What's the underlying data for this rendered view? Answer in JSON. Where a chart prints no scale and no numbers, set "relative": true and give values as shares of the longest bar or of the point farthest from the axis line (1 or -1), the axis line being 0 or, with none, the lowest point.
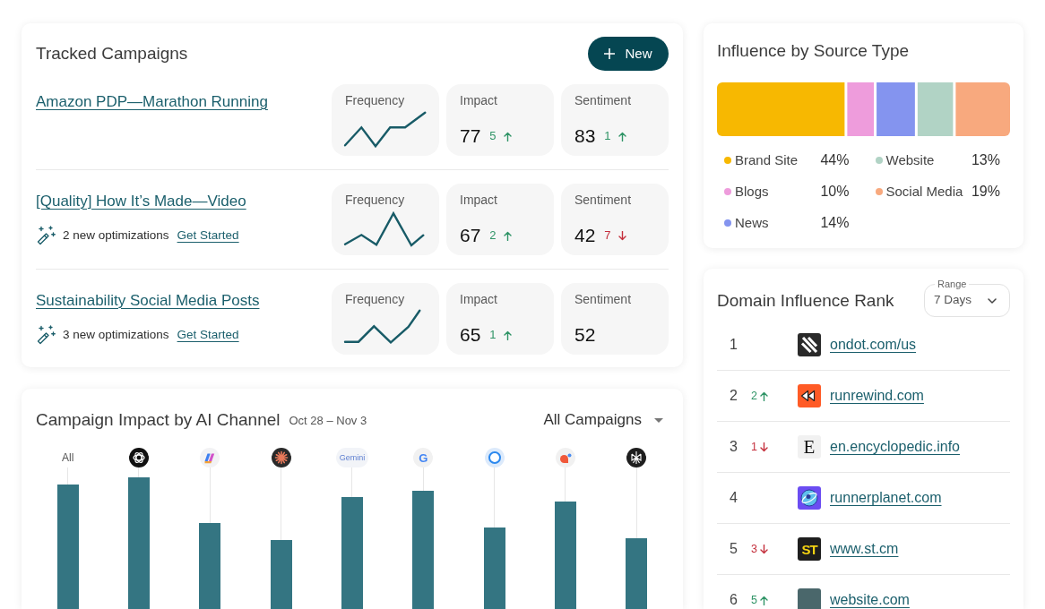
{
  "tracked_campaigns": {
    "title": "Tracked Campaigns",
    "new_button": "New",
    "campaigns": [
      {
        "title": "Amazon PDP—Marathon Running",
        "metrics": [
          {
            "kind": "sparkline",
            "label": "Frequency"
          },
          {
            "kind": "score",
            "label": "Impact",
            "value": "77",
            "change": "5",
            "rising": true
          },
          {
            "kind": "score",
            "label": "Sentiment",
            "value": "83",
            "change": "1",
            "rising": true
          }
        ]
      },
      {
        "title": "[Quality] How It’s Made—Video",
        "optimizations": {
          "text": "2 new optimizations",
          "link": "Get Started"
        },
        "metrics": [
          {
            "kind": "sparkline",
            "label": "Frequency"
          },
          {
            "kind": "score",
            "label": "Impact",
            "value": "67",
            "change": "2",
            "rising": true
          },
          {
            "kind": "score",
            "label": "Sentiment",
            "value": "42",
            "change": "7",
            "rising": false
          }
        ]
      },
      {
        "title": "Sustainability Social Media Posts",
        "optimizations": {
          "text": "3 new optimizations",
          "link": "Get Started"
        },
        "metrics": [
          {
            "kind": "sparkline",
            "label": "Frequency"
          },
          {
            "kind": "score",
            "label": "Impact",
            "value": "65",
            "change": "1",
            "rising": true
          },
          {
            "kind": "score",
            "label": "Sentiment",
            "value": "52"
          }
        ]
      }
    ]
  },
  "impact_chart": {
    "title": "Campaign Impact by AI Channel",
    "date_range": "Oct 28 – Nov 3",
    "filter": "All Campaigns",
    "channels": [
      {
        "kind": "text",
        "label": "All"
      },
      {
        "kind": "logo"
      },
      {
        "kind": "logo"
      },
      {
        "kind": "logo"
      },
      {
        "kind": "wordmark",
        "label": "Gemini"
      },
      {
        "kind": "letter",
        "label": "G"
      },
      {
        "kind": "logo"
      },
      {
        "kind": "logo"
      },
      {
        "kind": "logo"
      }
    ]
  },
  "source_influence": {
    "title": "Influence by Source Type",
    "chart_data": {
      "type": "bar",
      "orientation": "horizontal",
      "stacked": true,
      "relative": true,
      "legend": "bottom",
      "series": [
        {
          "name": "Brand Site",
          "color": "#f7b801",
          "values": [
            0.44
          ]
        },
        {
          "name": "Blogs",
          "color": "#ee9cdc",
          "values": [
            0.1
          ]
        },
        {
          "name": "News",
          "color": "#8494ef",
          "values": [
            0.14
          ]
        },
        {
          "name": "Website",
          "color": "#b1d3c5",
          "values": [
            0.13
          ]
        },
        {
          "name": "Social Media",
          "color": "#f8a97e",
          "values": [
            0.19
          ]
        }
      ],
      "value_labels": [
        "44%",
        "10%",
        "14%",
        "13%",
        "19%"
      ]
    }
  },
  "domain_rank": {
    "title": "Domain Influence Rank",
    "range": {
      "label": "Range",
      "value": "7 Days"
    },
    "rows": [
      {
        "rank": "1",
        "domain": "ondot.com/us"
      },
      {
        "rank": "2",
        "change": "2",
        "rising": true,
        "domain": "runrewind.com"
      },
      {
        "rank": "3",
        "change": "1",
        "rising": false,
        "logo_text": "E",
        "domain": "en.encyclopedic.info"
      },
      {
        "rank": "4",
        "domain": "runnerplanet.com"
      },
      {
        "rank": "5",
        "change": "3",
        "rising": false,
        "logo_text": "ST",
        "domain": "www.st.cm"
      },
      {
        "rank": "6",
        "change": "5",
        "rising": true,
        "domain": "website.com"
      }
    ]
  }
}
